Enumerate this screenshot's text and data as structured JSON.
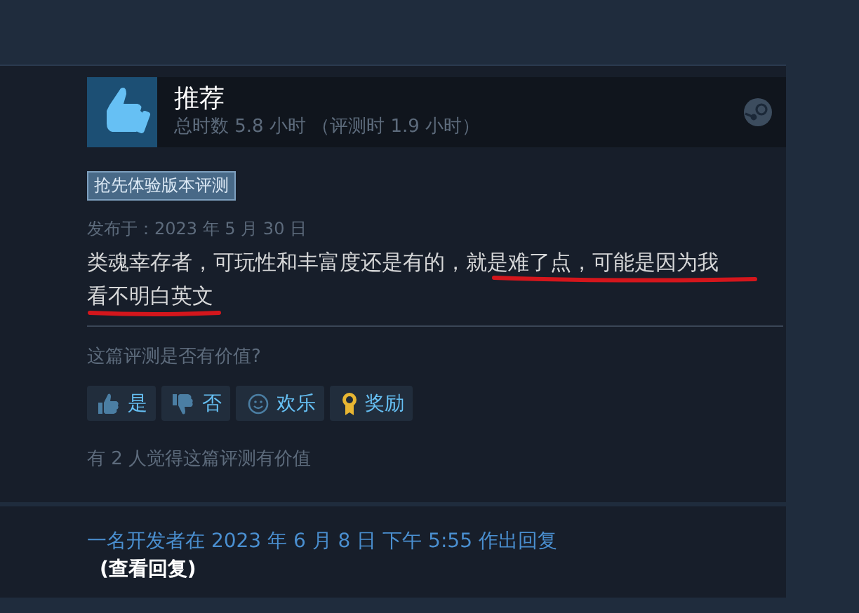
{
  "review": {
    "recommendation": "推荐",
    "hours": "总时数 5.8 小时 （评测时 1.9 小时）",
    "badge": "抢先体验版本评测",
    "posted": "发布于：2023 年 5 月 30 日",
    "text_lines": [
      "类魂幸存者，可玩性和丰富度还是有的，就是难了点，可能是因为我",
      "看不明白英文"
    ],
    "helpful_prompt": "这篇评测是否有价值?",
    "votes": [
      {
        "kind": "yes",
        "label": "是"
      },
      {
        "kind": "no",
        "label": "否"
      },
      {
        "kind": "funny",
        "label": "欢乐"
      },
      {
        "kind": "award",
        "label": "奖励"
      }
    ],
    "helpful_count": "有 2 人觉得这篇评测有价值"
  },
  "developer_reply": {
    "text": "一名开发者在 2023 年 6 月 8 日 下午 5:55 作出回复",
    "link": "(查看回复)"
  }
}
